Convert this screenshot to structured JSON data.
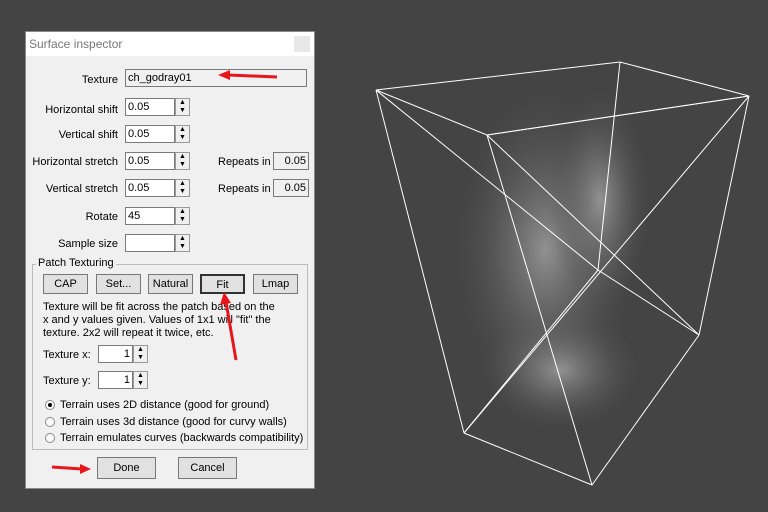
{
  "dialog": {
    "title": "Surface inspector",
    "texture_label": "Texture",
    "texture_value": "ch_godray01",
    "hshift_label": "Horizontal shift",
    "hshift": "0.05",
    "vshift_label": "Vertical shift",
    "vshift": "0.05",
    "hstretch_label": "Horizontal stretch",
    "hstretch": "0.05",
    "vstretch_label": "Vertical stretch",
    "vstretch": "0.05",
    "repeats_label": "Repeats in",
    "h_repeats": "0.05",
    "v_repeats": "0.05",
    "rotate_label": "Rotate",
    "rotate": "45",
    "sample_label": "Sample size",
    "sample": "",
    "patch": {
      "title": "Patch Texturing",
      "buttons": [
        "CAP",
        "Set...",
        "Natural",
        "Fit",
        "Lmap"
      ],
      "help": "Texture will be fit across the patch based on the x and y values given. Values of 1x1 will \"fit\" the texture. 2x2 will repeat it twice, etc.",
      "tex_x_label": "Texture x:",
      "tex_x": "1",
      "tex_y_label": "Texture y:",
      "tex_y": "1",
      "radios": [
        "Terrain uses 2D distance (good for ground)",
        "Terrain uses 3d distance (good for curvy walls)",
        "Terrain emulates curves (backwards compatibility)"
      ],
      "selected_radio": 0
    },
    "done": "Done",
    "cancel": "Cancel"
  },
  "colors": {
    "arrow": "#e8161b",
    "viewport_bg": "#444444"
  }
}
